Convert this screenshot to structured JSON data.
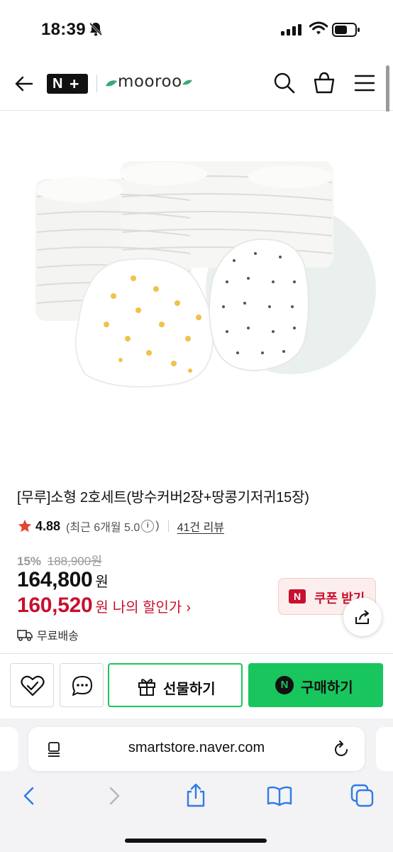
{
  "status": {
    "time": "18:39",
    "icons": [
      "bell-off-icon",
      "signal-icon",
      "wifi-icon",
      "battery-icon"
    ]
  },
  "header": {
    "logo_badge": "N+",
    "brand": "mooroo",
    "icons": [
      "back-arrow-icon",
      "search-icon",
      "shopping-bag-icon",
      "hamburger-menu-icon"
    ]
  },
  "product": {
    "title": "[무루]소형 2호세트(방수커버2장+땅콩기저귀15장)",
    "rating": "4.88",
    "rating_meta_prefix": "(최근 6개월 5.0",
    "rating_meta_suffix": ")",
    "review_count": "41건 리뷰",
    "discount_rate": "15%",
    "original_price": "188,900원",
    "sale_price": "164,800",
    "sale_unit": "원",
    "my_price": "160,520",
    "my_price_unit": "원",
    "my_price_label": "나의 할인가",
    "coupon_badge": "N",
    "coupon_label": "쿠폰 받기",
    "shipping": "무료배송"
  },
  "actions": {
    "gift_label": "선물하기",
    "buy_badge": "N",
    "buy_label": "구매하기"
  },
  "browser": {
    "url": "smartstore.naver.com"
  },
  "colors": {
    "accent_green": "#19c55d",
    "price_red": "#c8102e",
    "coupon_bg": "#fdeeee",
    "star": "#e2462f"
  }
}
